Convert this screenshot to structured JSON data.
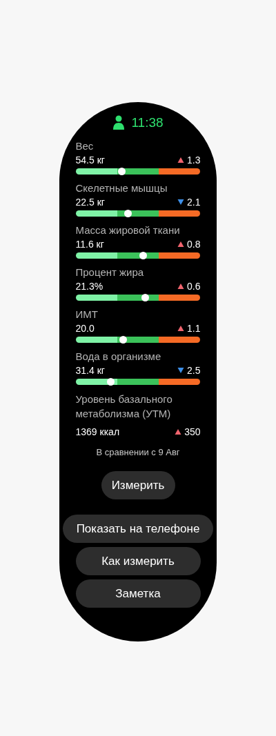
{
  "status": {
    "time": "11:38"
  },
  "metrics": [
    {
      "label": "Вес",
      "value": "54.5 кг",
      "change": "1.3",
      "kind": "up",
      "level": 0.37
    },
    {
      "label": "Скелетные мышцы",
      "value": "22.5 кг",
      "change": "2.1",
      "kind": "down",
      "level": 0.42
    },
    {
      "label": "Масса жировой ткани",
      "value": "11.6 кг",
      "change": "0.8",
      "kind": "up",
      "level": 0.54
    },
    {
      "label": "Процент жира",
      "value": "21.3%",
      "change": "0.6",
      "kind": "up",
      "level": 0.56
    },
    {
      "label": "ИМТ",
      "value": "20.0",
      "change": "1.1",
      "kind": "up",
      "level": 0.38
    },
    {
      "label": "Вода в организме",
      "value": "31.4 кг",
      "change": "2.5",
      "kind": "down",
      "level": 0.28
    }
  ],
  "bmr": {
    "label": "Уровень базального метаболизма (УТМ)",
    "value": "1369 ккал",
    "change": "350",
    "kind": "up"
  },
  "comparison": "В сравнении с 9 Авг",
  "buttons": [
    "Измерить",
    "Показать на телефоне",
    "Как измерить",
    "Заметка"
  ]
}
